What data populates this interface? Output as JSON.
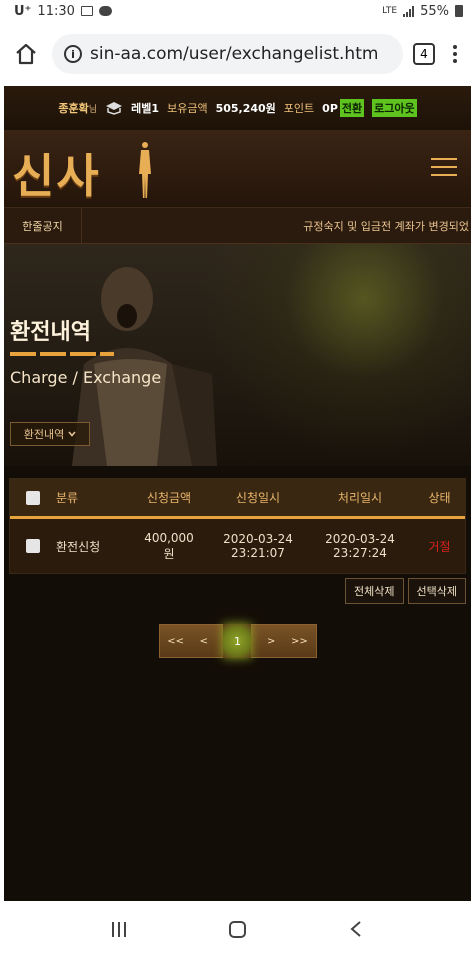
{
  "status_bar": {
    "carrier": "U⁺",
    "time": "11:30",
    "network": "LTE",
    "battery": "55%"
  },
  "browser": {
    "url": "sin-aa.com/user/exchangelist.htm",
    "tab_count": "4"
  },
  "site": {
    "top": {
      "user_name": "종훈확",
      "user_suffix": "님",
      "level": "레벨1",
      "balance_label": "보유금액",
      "balance": "505,240원",
      "point_label": "포인트",
      "point": "0P",
      "convert": "전환",
      "logout": "로그아웃"
    },
    "logo_text": "신사",
    "notice": {
      "label": "한줄공지",
      "text": "규정숙지 및 입금전 계좌가 변경되었"
    },
    "hero": {
      "title": "환전내역",
      "subtitle": "Charge / Exchange",
      "dropdown": "환전내역"
    },
    "table": {
      "headers": {
        "type": "분류",
        "amount": "신청금액",
        "requested": "신청일시",
        "processed": "처리일시",
        "status": "상태"
      },
      "rows": [
        {
          "type": "환전신청",
          "amount_line1": "400,000",
          "amount_line2": "원",
          "req_date": "2020-03-24",
          "req_time": "23:21:07",
          "done_date": "2020-03-24",
          "done_time": "23:27:24",
          "status": "거절"
        }
      ]
    },
    "buttons": {
      "delete_all": "전체삭제",
      "delete_selected": "선택삭제"
    },
    "pager": {
      "first": "<<",
      "prev": "<",
      "current": "1",
      "next": ">",
      "last": ">>"
    }
  },
  "colors": {
    "accent": "#e8a33c",
    "status_rejected": "#d8221c",
    "green": "#5ec21f"
  }
}
